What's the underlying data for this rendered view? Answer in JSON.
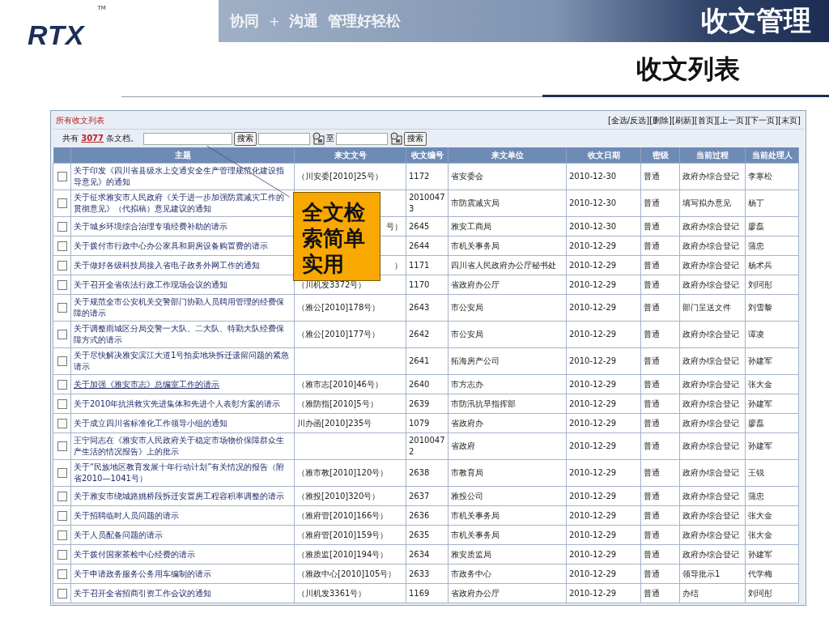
{
  "header": {
    "logo": "RTX",
    "trademark": "TM",
    "slogan": [
      {
        "text": "协同",
        "kind": "word"
      },
      {
        "text": "+",
        "kind": "plus"
      },
      {
        "text": "沟通",
        "kind": "word"
      },
      {
        "text": "管理好轻松",
        "kind": "word"
      }
    ],
    "title": "收文管理",
    "subtitle": "收文列表"
  },
  "panel": {
    "title": "所有收文列表",
    "actions": [
      "[全选/反选]",
      "[删除]",
      "[刷新]",
      "[首页]",
      "[上一页]",
      "[下一页]",
      "[末页]"
    ],
    "count_prefix": "共有",
    "count": "3077",
    "count_suffix": "条文档。",
    "search_button": "搜索",
    "date_to": "至",
    "date_search_button": "搜索"
  },
  "table": {
    "columns": [
      "主题",
      "来文文号",
      "收文编号",
      "来文单位",
      "收文日期",
      "密级",
      "当前过程",
      "当前处理人"
    ],
    "rows": [
      {
        "checked": false,
        "hovered": false,
        "cells": [
          "关于印发《四川省县级水上交通安全生产管理规范化建设指导意见》的通知",
          "（川安委[2010]25号）",
          "1172",
          "省安委会",
          "2010-12-30",
          "普通",
          "政府办综合登记",
          "李寒松"
        ]
      },
      {
        "checked": false,
        "hovered": false,
        "cells": [
          "关于征求雅安市人民政府《关于进一步加强防震减灾工作的贯彻意见》（代拟稿）意见建议的通知",
          "",
          "20100473",
          "市防震减灾局",
          "2010-12-30",
          "普通",
          "填写拟办意见",
          "杨丁"
        ]
      },
      {
        "checked": false,
        "hovered": false,
        "cells": [
          "关于城乡环境综合治理专项经费补助的请示",
          "号）",
          "2645",
          "雅安工商局",
          "2010-12-30",
          "普通",
          "政府办综合登记",
          "廖磊"
        ]
      },
      {
        "checked": false,
        "hovered": false,
        "cells": [
          "关于拨付市行政中心办公家具和厨房设备购置费的请示",
          "",
          "2644",
          "市机关事务局",
          "2010-12-29",
          "普通",
          "政府办综合登记",
          "蒲忠"
        ]
      },
      {
        "checked": false,
        "hovered": false,
        "cells": [
          "关于做好各级科技局接入省电子政务外网工作的通知",
          "）",
          "1171",
          "四川省人民政府办公厅秘书处",
          "2010-12-29",
          "普通",
          "政府办综合登记",
          "杨术兵"
        ]
      },
      {
        "checked": false,
        "hovered": false,
        "cells": [
          "关于召开全省依法行政工作现场会议的通知",
          "（川机发3372号）",
          "1170",
          "省政府办公厅",
          "2010-12-29",
          "普通",
          "政府办综合登记",
          "刘珂彤"
        ]
      },
      {
        "checked": false,
        "hovered": false,
        "cells": [
          "关于规范全市公安机关交警部门协勤人员聘用管理的经费保障的请示",
          "（雅公[2010]178号）",
          "2643",
          "市公安局",
          "2010-12-29",
          "普通",
          "部门呈送文件",
          "刘雪黎"
        ]
      },
      {
        "checked": false,
        "hovered": false,
        "cells": [
          "关于调整雨城区分局交警一大队、二大队、特勤大队经费保障方式的请示",
          "（雅公[2010]177号）",
          "2642",
          "市公安局",
          "2010-12-29",
          "普通",
          "政府办综合登记",
          "谭凌"
        ]
      },
      {
        "checked": false,
        "hovered": false,
        "cells": [
          "关于尽快解决雅安滨江大道1号拍卖地块拆迁遗留问题的紧急请示",
          "",
          "2641",
          "拓海房产公司",
          "2010-12-29",
          "普通",
          "政府办综合登记",
          "孙建军"
        ]
      },
      {
        "checked": false,
        "hovered": true,
        "cells": [
          "关于加强《雅安市志》总编室工作的请示",
          "（雅市志[2010]46号）",
          "2640",
          "市方志办",
          "2010-12-29",
          "普通",
          "政府办综合登记",
          "张大金"
        ]
      },
      {
        "checked": false,
        "hovered": false,
        "cells": [
          "关于2010年抗洪救灾先进集体和先进个人表彰方案的请示",
          "（雅防指[2010]5号）",
          "2639",
          "市防汛抗旱指挥部",
          "2010-12-29",
          "普通",
          "政府办综合登记",
          "孙建军"
        ]
      },
      {
        "checked": false,
        "hovered": false,
        "cells": [
          "关于成立四川省标准化工作领导小组的通知",
          "川办函[2010]235号",
          "1079",
          "省政府办",
          "2010-12-29",
          "普通",
          "政府办综合登记",
          "廖磊"
        ]
      },
      {
        "checked": false,
        "hovered": false,
        "cells": [
          "王宁同志在《雅安市人民政府关于稳定市场物价保障群众生产生活的情况报告》上的批示",
          "",
          "20100472",
          "省政府",
          "2010-12-29",
          "普通",
          "政府办综合登记",
          "孙建军"
        ]
      },
      {
        "checked": false,
        "hovered": false,
        "cells": [
          "关于“民族地区教育发展十年行动计划”有关情况的报告（附省2010—1041号）",
          "（雅市教[2010]120号）",
          "2638",
          "市教育局",
          "2010-12-29",
          "普通",
          "政府办综合登记",
          "王锐"
        ]
      },
      {
        "checked": false,
        "hovered": false,
        "cells": [
          "关于雅安市绕城路姚桥段拆迁安置房工程容积率调整的请示",
          "（雅投[2010]320号）",
          "2637",
          "雅投公司",
          "2010-12-29",
          "普通",
          "政府办综合登记",
          "蒲忠"
        ]
      },
      {
        "checked": false,
        "hovered": false,
        "cells": [
          "关于招聘临时人员问题的请示",
          "（雅府管[2010]166号）",
          "2636",
          "市机关事务局",
          "2010-12-29",
          "普通",
          "政府办综合登记",
          "张大金"
        ]
      },
      {
        "checked": false,
        "hovered": false,
        "cells": [
          "关于人员配备问题的请示",
          "（雅府管[2010]159号）",
          "2635",
          "市机关事务局",
          "2010-12-29",
          "普通",
          "政府办综合登记",
          "张大金"
        ]
      },
      {
        "checked": false,
        "hovered": false,
        "cells": [
          "关于拨付国家茶检中心经费的请示",
          "（雅质监[2010]194号）",
          "2634",
          "雅安质监局",
          "2010-12-29",
          "普通",
          "政府办综合登记",
          "孙建军"
        ]
      },
      {
        "checked": false,
        "hovered": false,
        "cells": [
          "关于申请政务服务公务用车编制的请示",
          "（雅政中心[2010]105号）",
          "2633",
          "市政务中心",
          "2010-12-29",
          "普通",
          "领导批示1",
          "代学梅"
        ]
      },
      {
        "checked": false,
        "hovered": false,
        "cells": [
          "关于召开全省招商引资工作会议的通知",
          "（川机发3361号）",
          "1169",
          "省政府办公厅",
          "2010-12-29",
          "普通",
          "办结",
          "刘珂彤"
        ]
      }
    ]
  },
  "callout": {
    "text": "全文检索简单实用"
  }
}
